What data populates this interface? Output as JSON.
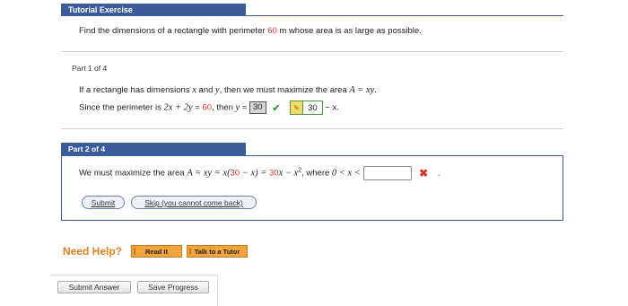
{
  "header": {
    "title": "Tutorial Exercise"
  },
  "task": {
    "text_before": "Find the dimensions of a rectangle with perimeter ",
    "perimeter": "60",
    "text_after": " m whose area is as large as possible."
  },
  "part1": {
    "label": "Part 1 of 4",
    "line1_text": "If a rectangle has dimensions ",
    "line1_x": "x",
    "line1_and": " and ",
    "line1_y": "y",
    "line1_rest": ", then we must maximize the area ",
    "line1_math": "A = xy",
    "line1_end": ".",
    "line2_text": "Since the perimeter is ",
    "line2_math": "2x + 2y",
    "line2_eq": " = ",
    "line2_val": "60",
    "line2_then": ",  then ",
    "line2_y": "y",
    "line2_eq2": " = ",
    "answer_value": "30",
    "check_icon": "check-icon",
    "key_value": "30",
    "line2_tail": " − x."
  },
  "part2": {
    "label": "Part 2 of 4",
    "text1": "We must maximize the area ",
    "math1": "A = xy = x(",
    "red1": "30",
    "math2": " − x) = ",
    "red2": "30",
    "math3": "x − x",
    "sup": "2",
    "text2": ",  where ",
    "math4": "0 < x <",
    "input_value": "",
    "x_icon": "cross-icon",
    "tail": "."
  },
  "buttons": {
    "submit": "Submit",
    "skip": "Skip (you cannot come back)",
    "read_it": "Read It",
    "talk_tutor": "Talk to a Tutor",
    "submit_answer": "Submit Answer",
    "save_progress": "Save Progress"
  },
  "help": {
    "label": "Need Help?"
  }
}
